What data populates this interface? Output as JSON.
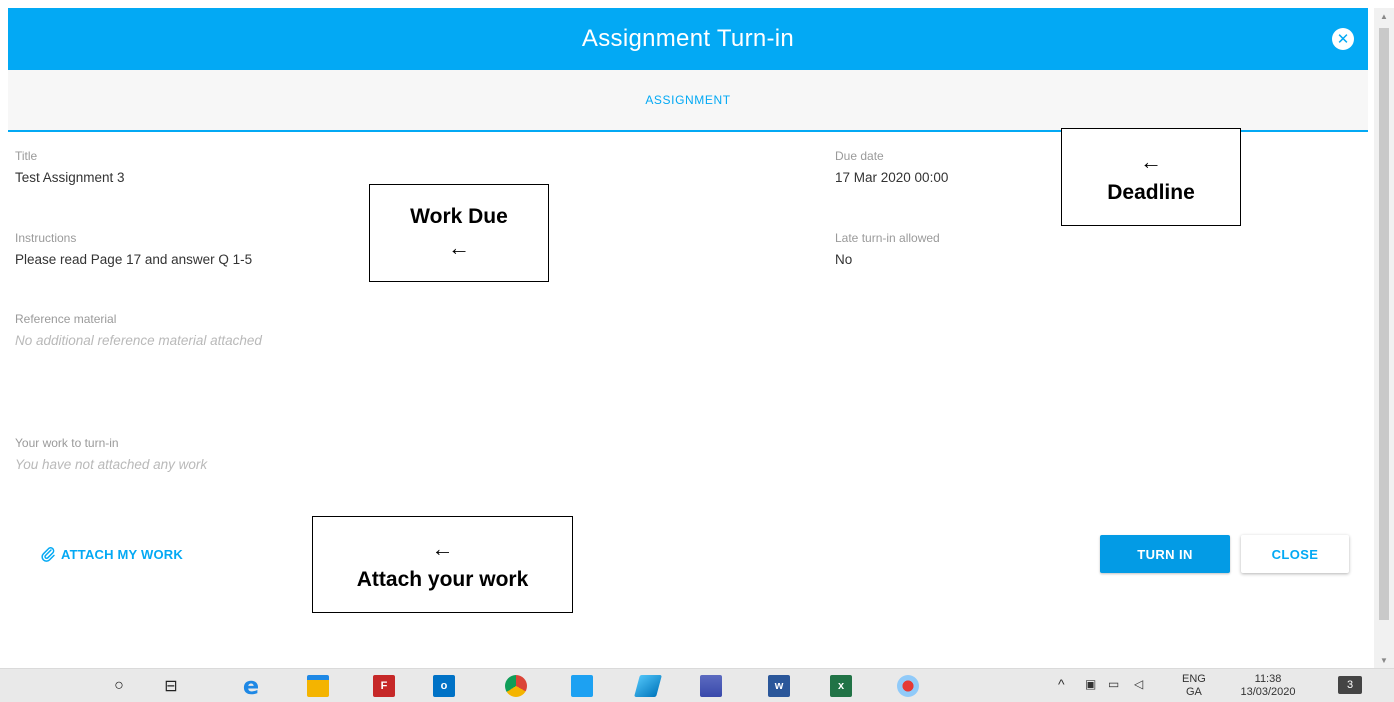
{
  "modal": {
    "title": "Assignment Turn-in",
    "tab_label": "ASSIGNMENT",
    "fields": {
      "title": {
        "label": "Title",
        "value": "Test Assignment 3"
      },
      "instructions": {
        "label": "Instructions",
        "value": "Please read Page 17 and answer Q 1-5"
      },
      "reference": {
        "label": "Reference material",
        "value": "No additional reference material attached"
      },
      "your_work": {
        "label": "Your work to turn-in",
        "value": "You have not attached any work"
      },
      "due_date": {
        "label": "Due date",
        "value": "17 Mar 2020 00:00"
      },
      "late": {
        "label": "Late turn-in allowed",
        "value": "No"
      }
    },
    "attach_label": "ATTACH MY WORK",
    "turn_in_label": "TURN IN",
    "close_label": "CLOSE"
  },
  "annotations": {
    "work_due": {
      "text": "Work Due",
      "arrow": "←"
    },
    "deadline": {
      "text": "Deadline",
      "arrow": "←"
    },
    "attach": {
      "text": "Attach your work",
      "arrow": "←"
    }
  },
  "icons": {
    "close": "close-circle-icon",
    "attach": "paperclip-icon"
  },
  "colors": {
    "accent": "#03a9f4",
    "button": "#039be5"
  },
  "taskbar": {
    "apps": [
      {
        "name": "search-circle-icon",
        "glyph": "○"
      },
      {
        "name": "task-view-icon",
        "glyph": "⊟"
      },
      {
        "name": "edge-icon",
        "glyph": "e"
      },
      {
        "name": "file-explorer-icon",
        "glyph": ""
      },
      {
        "name": "filezilla-icon",
        "glyph": "F"
      },
      {
        "name": "outlook-icon",
        "glyph": "o"
      },
      {
        "name": "chrome-icon",
        "glyph": ""
      },
      {
        "name": "twitter-icon",
        "glyph": ""
      },
      {
        "name": "notes-icon",
        "glyph": ""
      },
      {
        "name": "remote-desktop-icon",
        "glyph": ""
      },
      {
        "name": "word-icon",
        "glyph": "w"
      },
      {
        "name": "excel-icon",
        "glyph": "x"
      },
      {
        "name": "snipping-tool-icon",
        "glyph": ""
      }
    ],
    "language": "ENG",
    "language_sub": "GA",
    "time": "11:38",
    "date": "13/03/2020",
    "notifications": "3"
  }
}
